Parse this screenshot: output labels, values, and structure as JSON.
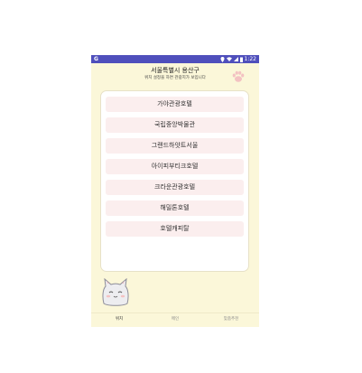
{
  "status_bar": {
    "carrier_icon_label": "G",
    "time": "1:22",
    "icons": [
      "location-icon",
      "wifi-icon",
      "signal-icon",
      "battery-icon"
    ]
  },
  "header": {
    "title": "서울특별시 용산구",
    "subtitle": "위치 설정을 하면 관광지가 보입니다"
  },
  "places": [
    {
      "label": "가야관광호텔"
    },
    {
      "label": "국립중앙박물관"
    },
    {
      "label": "그랜드하얏트서울"
    },
    {
      "label": "아이피부티크호텔"
    },
    {
      "label": "크라운관광호텔"
    },
    {
      "label": "해밀톤호텔"
    },
    {
      "label": "호텔캐피탈"
    }
  ],
  "tabs": [
    {
      "label": "위치",
      "active": true
    },
    {
      "label": "메인",
      "active": false
    },
    {
      "label": "맞춤추천",
      "active": false
    }
  ],
  "colors": {
    "status_bar": "#4f4fbc",
    "background": "#fbf7d9",
    "item_background": "#fbeeee",
    "tab_indicator": "#4a9a7a"
  }
}
